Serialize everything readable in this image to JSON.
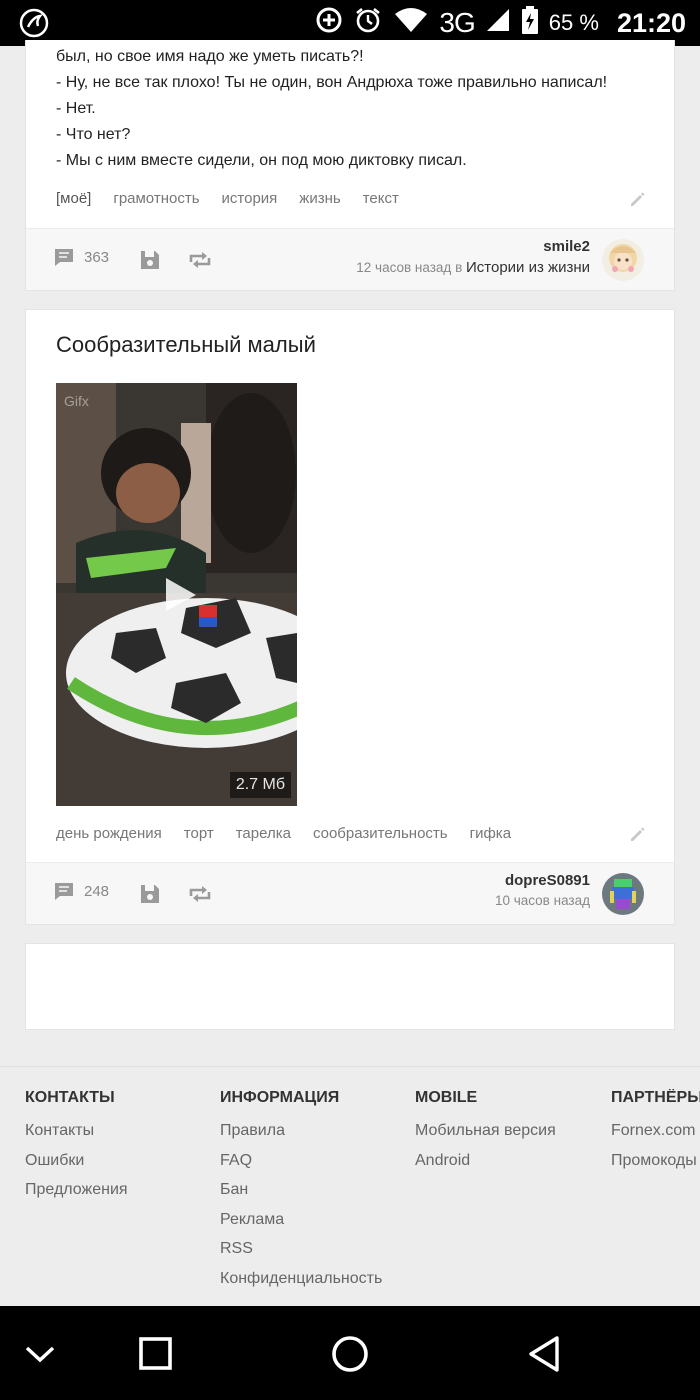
{
  "status_bar": {
    "network": "3G",
    "battery": "65 %",
    "time": "21:20",
    "icons": [
      "vk-icon",
      "data-saver-icon",
      "alarm-icon",
      "wifi-icon",
      "signal-icon",
      "battery-charging-icon"
    ]
  },
  "post1": {
    "lines": [
      "был, но свое имя надо же уметь писать?!",
      "- Ну, не все так плохо! Ты не один, вон Андрюха тоже правильно написал!",
      "- Нет.",
      "- Что нет?",
      "- Мы с ним вместе сидели, он под мою диктовку писал."
    ],
    "tags": [
      "[моё]",
      "грамотность",
      "история",
      "жизнь",
      "текст"
    ],
    "comments": "363",
    "author": "smile2",
    "time": "12 часов назад",
    "in_word": "в",
    "community": "Истории из жизни"
  },
  "post2": {
    "title": "Сообразительный малый",
    "gif_watermark": "Gifx",
    "gif_size": "2.7 Мб",
    "tags": [
      "день рождения",
      "торт",
      "тарелка",
      "сообразительность",
      "гифка"
    ],
    "comments": "248",
    "author": "dopreS0891",
    "time": "10 часов назад"
  },
  "footer": {
    "columns": [
      {
        "title": "КОНТАКТЫ",
        "links": [
          "Контакты",
          "Ошибки",
          "Предложения"
        ]
      },
      {
        "title": "ИНФОРМАЦИЯ",
        "links": [
          "Правила",
          "FAQ",
          "Бан",
          "Реклама",
          "RSS",
          "Конфиденциальность"
        ]
      },
      {
        "title": "MOBILE",
        "links": [
          "Мобильная версия",
          "Android"
        ]
      },
      {
        "title": "ПАРТНЁРЫ",
        "links": [
          "Fornex.com",
          "Промокоды"
        ]
      }
    ]
  },
  "nav_bar": {
    "buttons": [
      "hide-keyboard-icon",
      "recents-icon",
      "home-icon",
      "back-icon"
    ]
  }
}
